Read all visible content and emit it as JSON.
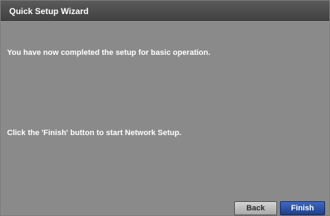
{
  "window": {
    "title": "Quick Setup Wizard"
  },
  "body": {
    "message_complete": "You have now completed the setup for basic operation.",
    "message_instruction": "Click the 'Finish' button to start Network Setup."
  },
  "buttons": {
    "back_label": "Back",
    "finish_label": "Finish"
  },
  "colors": {
    "panel_background": "#8a8a8a",
    "titlebar": "#4a4a4a",
    "finish_button": "#2d4fa3",
    "back_button": "#bdbdbd"
  }
}
